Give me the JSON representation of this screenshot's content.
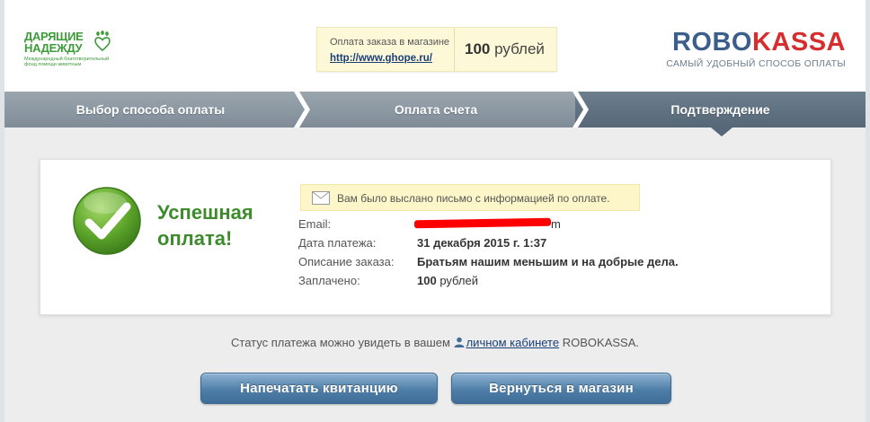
{
  "header": {
    "left_logo": {
      "line1": "ДАРЯЩИЕ",
      "line2": "НАДЕЖДУ",
      "subtitle": "Международный благотворительный фонд помощи животным"
    },
    "order": {
      "caption": "Оплата заказа в магазине",
      "shop_link": "http://www.ghope.ru/",
      "amount_value": "100",
      "amount_currency": "рублей"
    },
    "robokassa": {
      "name_part1": "ROBO",
      "name_part2": "KASSA",
      "tagline": "САМЫЙ УДОБНЫЙ СПОСОБ ОПЛАТЫ"
    }
  },
  "steps": [
    {
      "label": "Выбор способа оплаты",
      "active": false
    },
    {
      "label": "Оплата счета",
      "active": false
    },
    {
      "label": "Подтверждение",
      "active": true
    }
  ],
  "result": {
    "title_line1": "Успешная",
    "title_line2": "оплата!",
    "notice": "Вам было выслано письмо с информацией по оплате.",
    "rows": {
      "email": {
        "label": "Email:",
        "value_tail": "m"
      },
      "date": {
        "label": "Дата платежа:",
        "value": "31 декабря 2015 г. 1:37"
      },
      "description": {
        "label": "Описание заказа:",
        "value": "Братьям нашим меньшим и на добрые дела."
      },
      "paid": {
        "label": "Заплачено:",
        "value_amount": "100",
        "value_currency": "рублей"
      }
    }
  },
  "status_line": {
    "prefix": "Статус платежа можно увидеть в вашем",
    "link": "личном кабинете",
    "suffix": "ROBOKASSA."
  },
  "buttons": {
    "print": "Напечатать квитанцию",
    "back": "Вернуться в магазин"
  },
  "colors": {
    "brand_green": "#3d9b3a",
    "robo_blue": "#3b5f8a",
    "robo_red": "#d62e2e",
    "success_green": "#3d8b2c",
    "notice_bg": "#fcf6c8"
  }
}
